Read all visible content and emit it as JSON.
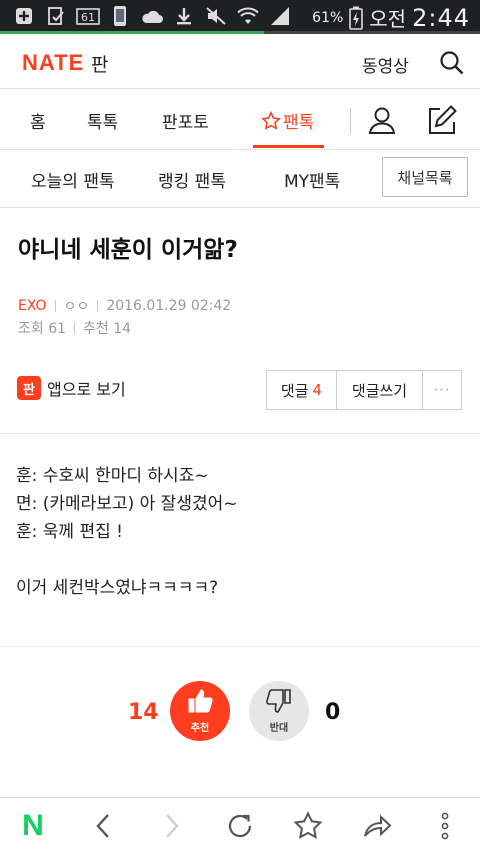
{
  "status_bar": {
    "battery_pct": "61%",
    "ampm": "오전",
    "time": "2:44",
    "load_progress": 0.55
  },
  "header": {
    "logo": "NATE",
    "section": "판",
    "video_link": "동영상"
  },
  "main_nav": {
    "items": [
      "홈",
      "톡톡",
      "판포토",
      "팬톡"
    ],
    "active": "팬톡"
  },
  "sub_nav": {
    "items": [
      "오늘의 팬톡",
      "랭킹 팬톡",
      "MY팬톡"
    ],
    "channel_list": "채널목록"
  },
  "post": {
    "title": "야니네 세훈이 이거앎?",
    "category": "EXO",
    "author": "ㅇㅇ",
    "datetime": "2016.01.29 02:42",
    "views": "조회 61",
    "recommends_label": "추천 14",
    "body_lines": [
      "훈: 수호씨 한마디 하시죠~",
      "면: (카메라보고) 아 잘생겼어~",
      "훈: 욱께 편집 !",
      "",
      "이거 세컨박스였냐ㅋㅋㅋㅋ?"
    ]
  },
  "actions": {
    "app_view": "앱으로 보기",
    "app_icon_text": "판",
    "comments_label": "댓글",
    "comments_count": "4",
    "write_comment": "댓글쓰기",
    "more": "···"
  },
  "vote": {
    "recommend_count": "14",
    "recommend_label": "추천",
    "oppose_label": "반대",
    "oppose_count": "0"
  },
  "bottom_bar": {
    "home_letter": "N"
  },
  "colors": {
    "accent": "#ff3d1f",
    "status_bg": "#1e2024",
    "naver_green": "#19ce60"
  }
}
